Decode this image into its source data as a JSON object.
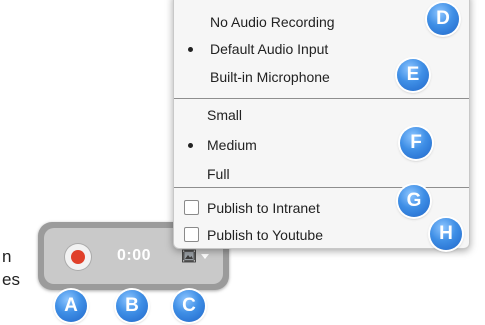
{
  "side_text": {
    "line1": "n",
    "line2": "es"
  },
  "recorder": {
    "timer": "0:00",
    "record_icon": "record-icon",
    "quality_icon": "film-icon",
    "chevron_icon": "chevron-down-icon",
    "record_color": "#e0402a"
  },
  "menu": {
    "audio": {
      "items": [
        {
          "label": "No Audio Recording",
          "selected": false
        },
        {
          "label": "Default Audio Input",
          "selected": true
        },
        {
          "label": "Built-in Microphone",
          "selected": false
        }
      ]
    },
    "size": {
      "items": [
        {
          "label": "Small",
          "selected": false
        },
        {
          "label": "Medium",
          "selected": true
        },
        {
          "label": "Full",
          "selected": false
        }
      ]
    },
    "publish": {
      "items": [
        {
          "label": "Publish to Intranet",
          "checked": false
        },
        {
          "label": "Publish to Youtube",
          "checked": false
        }
      ]
    }
  },
  "badges": {
    "a": "A",
    "b": "B",
    "c": "C",
    "d": "D",
    "e": "E",
    "f": "F",
    "g": "G",
    "h": "H",
    "color": "#3f8fe6"
  }
}
